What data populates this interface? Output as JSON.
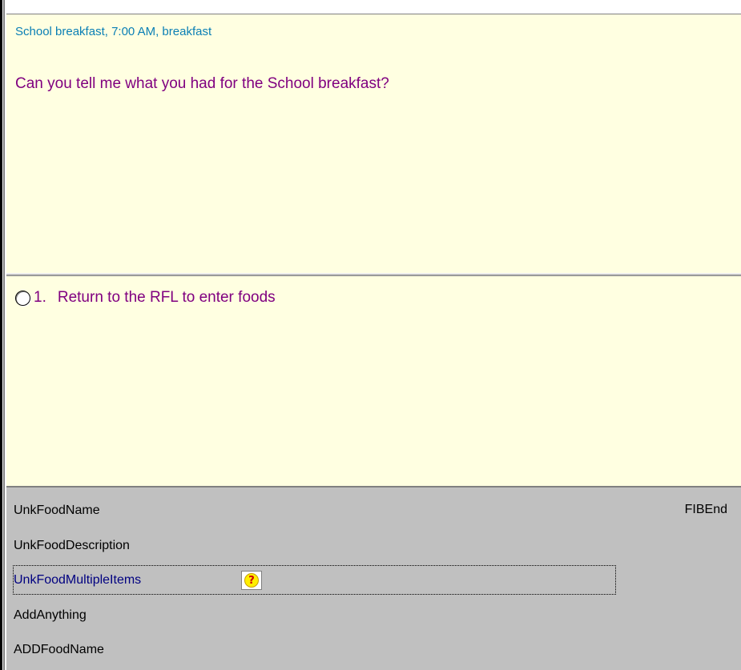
{
  "question": {
    "context": "School breakfast, 7:00 AM, breakfast",
    "text": "Can you tell me what you had for the School breakfast?"
  },
  "answers": {
    "options": [
      {
        "number": "1.",
        "label": "Return to the RFL to enter foods"
      }
    ]
  },
  "fields": {
    "items": [
      {
        "label": "UnkFoodName"
      },
      {
        "label": "UnkFoodDescription"
      },
      {
        "label": "UnkFoodMultipleItems"
      },
      {
        "label": "AddAnything"
      },
      {
        "label": "ADDFoodName"
      }
    ],
    "end_label": "FIBEnd",
    "help_icon": "question-mark-icon"
  },
  "colors": {
    "panel_background": "#ffffe1",
    "context_text": "#0a7fb5",
    "question_text": "#800080",
    "active_field_text": "#000080",
    "fields_background": "#c0c0c0"
  }
}
